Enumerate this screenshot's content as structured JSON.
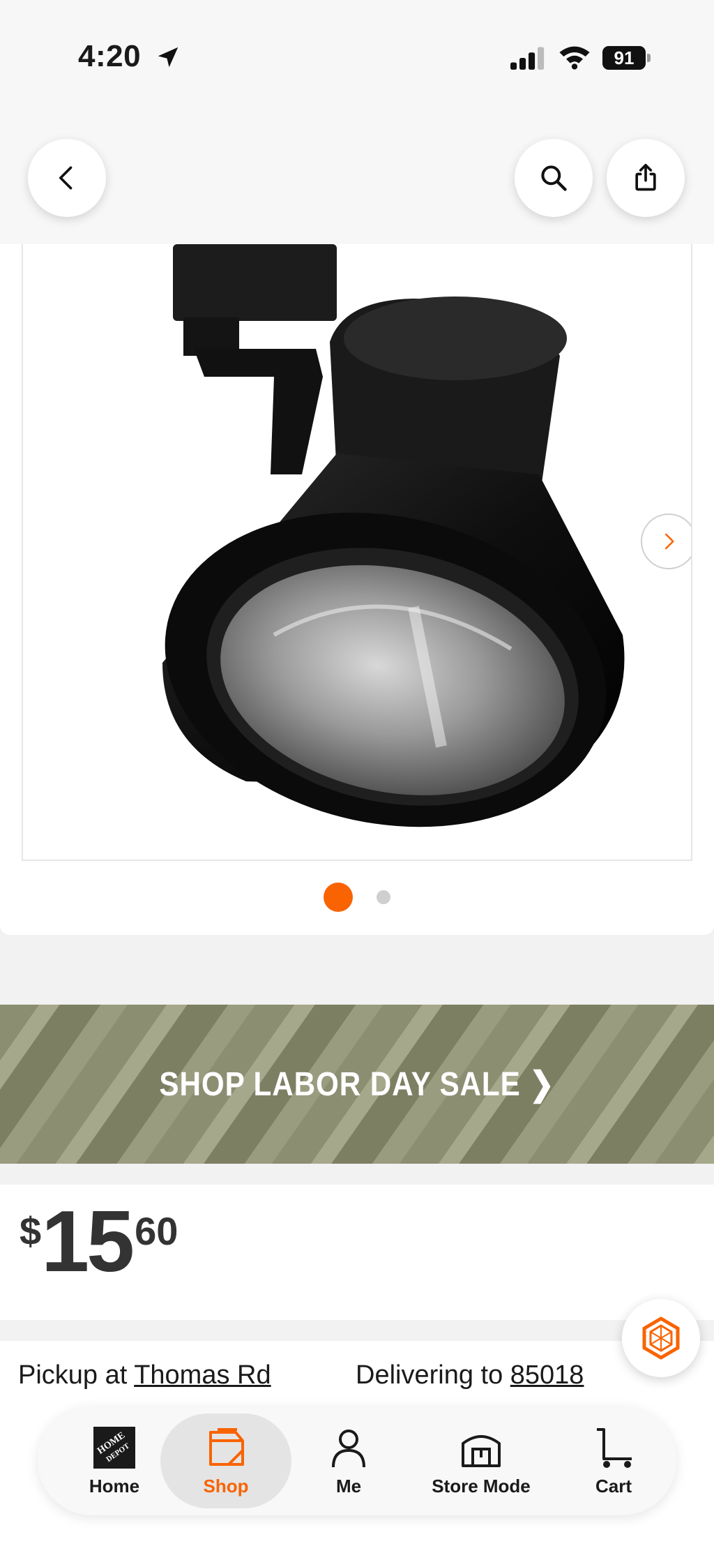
{
  "status_bar": {
    "time": "4:20",
    "battery": "91"
  },
  "product": {
    "image_alt": "Black track light head",
    "gallery_dots": 2,
    "active_dot": 0
  },
  "banner": {
    "label": "SHOP LABOR DAY SALE ❯"
  },
  "price": {
    "currency": "$",
    "dollars": "15",
    "cents": "60"
  },
  "fulfillment": {
    "pickup_prefix": "Pickup at ",
    "pickup_store": "Thomas Rd",
    "deliver_prefix": "Delivering to ",
    "deliver_zip": "85018"
  },
  "tabbar": {
    "items": [
      {
        "label": "Home",
        "icon": "home-depot-logo-icon"
      },
      {
        "label": "Shop",
        "icon": "shop-bag-icon",
        "active": true
      },
      {
        "label": "Me",
        "icon": "person-icon"
      },
      {
        "label": "Store Mode",
        "icon": "store-icon"
      },
      {
        "label": "Cart",
        "icon": "cart-icon"
      }
    ]
  },
  "colors": {
    "accent": "#f96302",
    "banner": "#8c8e72"
  }
}
